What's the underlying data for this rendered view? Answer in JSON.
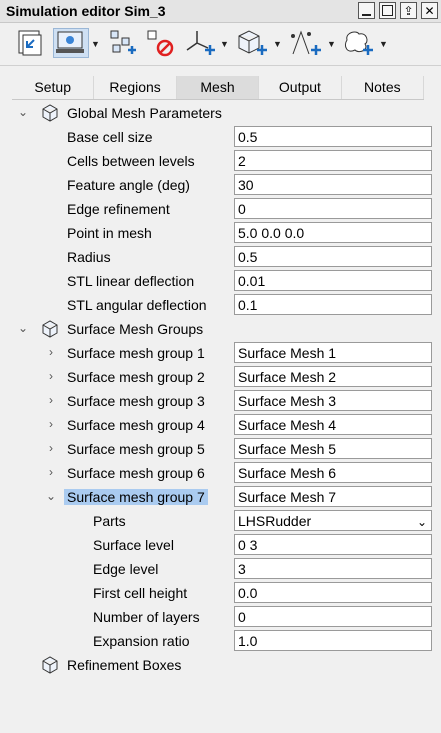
{
  "window": {
    "title": "Simulation editor Sim_3"
  },
  "tabs": [
    {
      "label": "Setup"
    },
    {
      "label": "Regions"
    },
    {
      "label": "Mesh"
    },
    {
      "label": "Output"
    },
    {
      "label": "Notes"
    }
  ],
  "toolbar": {
    "icons": [
      "import-icon",
      "simulation-view-icon",
      "network-add-icon",
      "delete-object-icon",
      "add-axes-icon",
      "add-cube-icon",
      "add-probe-icon",
      "add-surface-icon"
    ]
  },
  "global": {
    "title": "Global Mesh Parameters",
    "params": [
      {
        "label": "Base cell size",
        "value": "0.5"
      },
      {
        "label": "Cells between levels",
        "value": "2"
      },
      {
        "label": "Feature angle (deg)",
        "value": "30"
      },
      {
        "label": "Edge refinement",
        "value": "0"
      },
      {
        "label": "Point in mesh",
        "value": "5.0 0.0 0.0"
      },
      {
        "label": "Radius",
        "value": "0.5"
      },
      {
        "label": "STL linear deflection",
        "value": "0.01"
      },
      {
        "label": "STL angular deflection",
        "value": "0.1"
      }
    ]
  },
  "surface": {
    "title": "Surface Mesh Groups",
    "groups": [
      {
        "label": "Surface mesh group 1",
        "value": "Surface Mesh 1"
      },
      {
        "label": "Surface mesh group 2",
        "value": "Surface Mesh 2"
      },
      {
        "label": "Surface mesh group 3",
        "value": "Surface Mesh 3"
      },
      {
        "label": "Surface mesh group 4",
        "value": "Surface Mesh 4"
      },
      {
        "label": "Surface mesh group 5",
        "value": "Surface Mesh 5"
      },
      {
        "label": "Surface mesh group 6",
        "value": "Surface Mesh 6"
      },
      {
        "label": "Surface mesh group 7",
        "value": "Surface Mesh 7"
      }
    ],
    "group7": [
      {
        "label": "Parts",
        "value": "LHSRudder"
      },
      {
        "label": "Surface level",
        "value": "0 3"
      },
      {
        "label": "Edge level",
        "value": "3"
      },
      {
        "label": "First cell height",
        "value": "0.0"
      },
      {
        "label": "Number of layers",
        "value": "0"
      },
      {
        "label": "Expansion ratio",
        "value": "1.0"
      }
    ]
  },
  "refinement": {
    "title": "Refinement Boxes"
  }
}
